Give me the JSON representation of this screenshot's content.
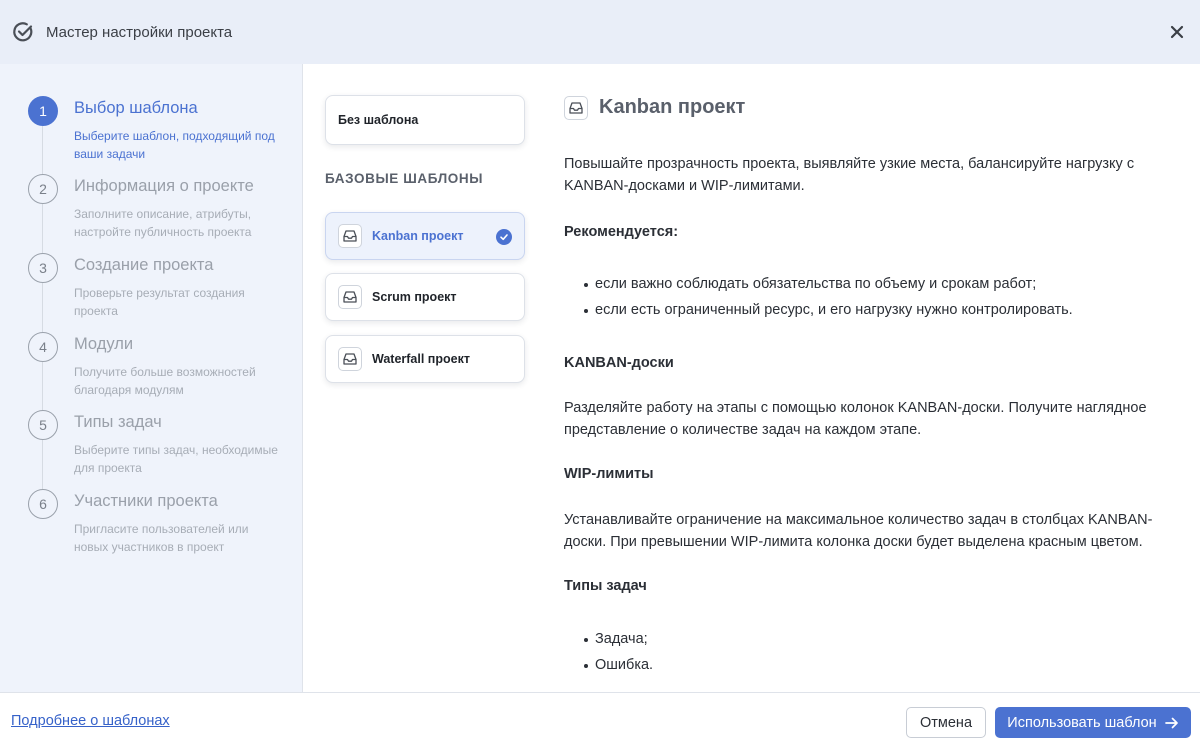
{
  "header": {
    "title": "Мастер настройки проекта",
    "logo_icon": "check-circle-icon",
    "close_icon": "close-icon"
  },
  "steps": [
    {
      "number": "1",
      "name": "Выбор шаблона",
      "desc": "Выберите шаблон, подходящий под ваши задачи",
      "active": true
    },
    {
      "number": "2",
      "name": "Информация о проекте",
      "desc": "Заполните описание, атрибуты, настройте публичность проекта",
      "active": false
    },
    {
      "number": "3",
      "name": "Создание проекта",
      "desc": "Проверьте результат создания проекта",
      "active": false
    },
    {
      "number": "4",
      "name": "Модули",
      "desc": "Получите больше возможностей благодаря модулям",
      "active": false
    },
    {
      "number": "5",
      "name": "Типы задач",
      "desc": "Выберите типы задач, необходимые для проекта",
      "active": false
    },
    {
      "number": "6",
      "name": "Участники проекта",
      "desc": "Пригласите пользователей или новых участников в проект",
      "active": false
    }
  ],
  "templates": {
    "no_template": "Без шаблона",
    "section_title": "БАЗОВЫЕ ШАБЛОНЫ",
    "items": [
      {
        "label": "Kanban проект",
        "icon": "inbox-icon",
        "selected": true
      },
      {
        "label": "Scrum проект",
        "icon": "inbox-icon",
        "selected": false
      },
      {
        "label": "Waterfall проект",
        "icon": "inbox-icon",
        "selected": false
      }
    ]
  },
  "details": {
    "title": "Kanban проект",
    "intro": "Повышайте прозрачность проекта, выявляйте узкие места, балансируйте нагрузку с KANBAN-досками и WIP-лимитами.",
    "recommended_title": "Рекомендуется:",
    "recommended": [
      "если важно соблюдать обязательства по объему и срокам работ;",
      "если есть ограниченный ресурс, и его нагрузку нужно контролировать."
    ],
    "boards_title": "KANBAN-доски",
    "boards_text": "Разделяйте работу на этапы с помощью колонок KANBAN-доски. Получите наглядное представление о количестве задач на каждом этапе.",
    "wip_title": "WIP-лимиты",
    "wip_text": "Устанавливайте ограничение на максимальное количество задач в столбцах KANBAN-доски. При превышении WIP-лимита колонка доски будет выделена красным цветом.",
    "types_title": "Типы задач",
    "types": [
      "Задача;",
      "Ошибка."
    ]
  },
  "footer": {
    "more_link": "Подробнее о шаблонах",
    "cancel": "Отмена",
    "use": "Использовать шаблон"
  },
  "colors": {
    "accent": "#4b72d1",
    "header_bg": "#e9eef8",
    "sidebar_bg": "#eff3fb"
  }
}
